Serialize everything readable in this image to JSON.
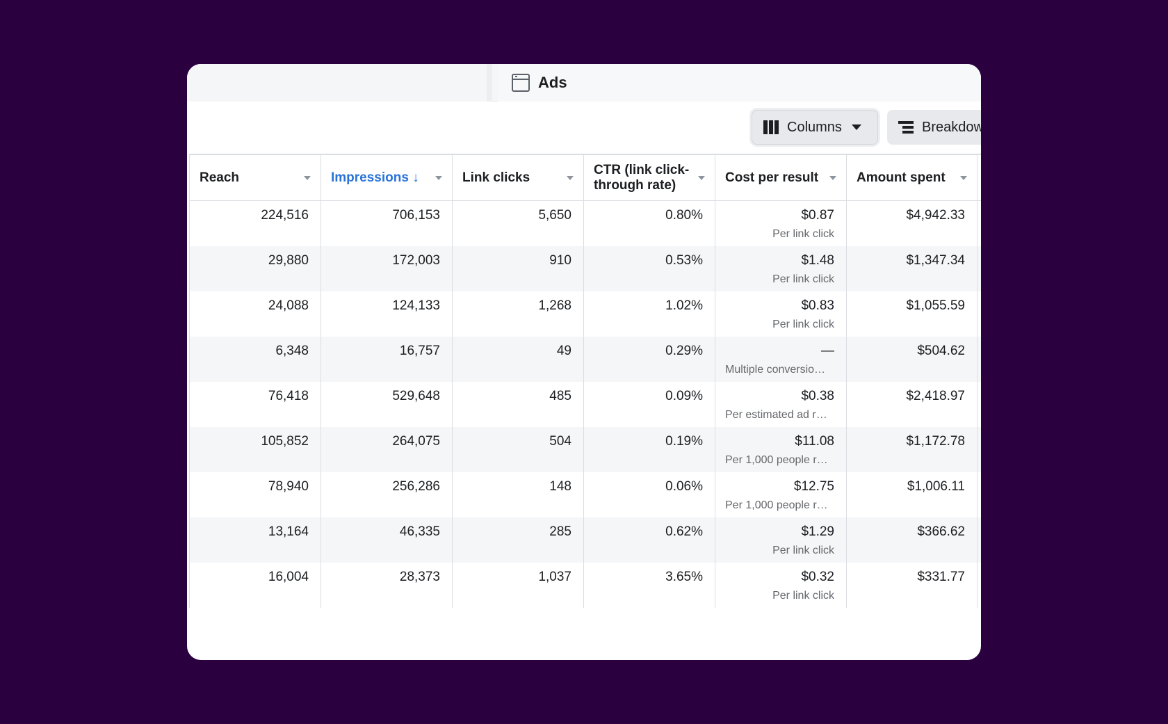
{
  "tab": {
    "label": "Ads",
    "icon": "ads-window-icon"
  },
  "toolbar": {
    "columns_label": "Columns",
    "breakdown_label": "Breakdow"
  },
  "table": {
    "headers": [
      {
        "label": "Reach",
        "sorted": false
      },
      {
        "label": "Impressions ↓",
        "sorted": true
      },
      {
        "label": "Link clicks",
        "sorted": false
      },
      {
        "label": "CTR (link click-through rate)",
        "sorted": false
      },
      {
        "label": "Cost per result",
        "sorted": false
      },
      {
        "label": "Amount spent",
        "sorted": false
      }
    ],
    "rows": [
      {
        "reach": "224,516",
        "impressions": "706,153",
        "link_clicks": "5,650",
        "ctr": "0.80%",
        "cost": "$0.87",
        "cost_note": "Per link click",
        "spent": "$4,942.33"
      },
      {
        "reach": "29,880",
        "impressions": "172,003",
        "link_clicks": "910",
        "ctr": "0.53%",
        "cost": "$1.48",
        "cost_note": "Per link click",
        "spent": "$1,347.34"
      },
      {
        "reach": "24,088",
        "impressions": "124,133",
        "link_clicks": "1,268",
        "ctr": "1.02%",
        "cost": "$0.83",
        "cost_note": "Per link click",
        "spent": "$1,055.59"
      },
      {
        "reach": "6,348",
        "impressions": "16,757",
        "link_clicks": "49",
        "ctr": "0.29%",
        "cost": "—",
        "cost_note": "Multiple conversio…",
        "spent": "$504.62"
      },
      {
        "reach": "76,418",
        "impressions": "529,648",
        "link_clicks": "485",
        "ctr": "0.09%",
        "cost": "$0.38",
        "cost_note": "Per estimated ad r…",
        "spent": "$2,418.97"
      },
      {
        "reach": "105,852",
        "impressions": "264,075",
        "link_clicks": "504",
        "ctr": "0.19%",
        "cost": "$11.08",
        "cost_note": "Per 1,000 people r…",
        "spent": "$1,172.78"
      },
      {
        "reach": "78,940",
        "impressions": "256,286",
        "link_clicks": "148",
        "ctr": "0.06%",
        "cost": "$12.75",
        "cost_note": "Per 1,000 people r…",
        "spent": "$1,006.11"
      },
      {
        "reach": "13,164",
        "impressions": "46,335",
        "link_clicks": "285",
        "ctr": "0.62%",
        "cost": "$1.29",
        "cost_note": "Per link click",
        "spent": "$366.62"
      },
      {
        "reach": "16,004",
        "impressions": "28,373",
        "link_clicks": "1,037",
        "ctr": "3.65%",
        "cost": "$0.32",
        "cost_note": "Per link click",
        "spent": "$331.77"
      }
    ]
  },
  "colors": {
    "background": "#2a003f",
    "accent_sorted": "#2a74d9",
    "row_alt": "#f5f6f7"
  }
}
